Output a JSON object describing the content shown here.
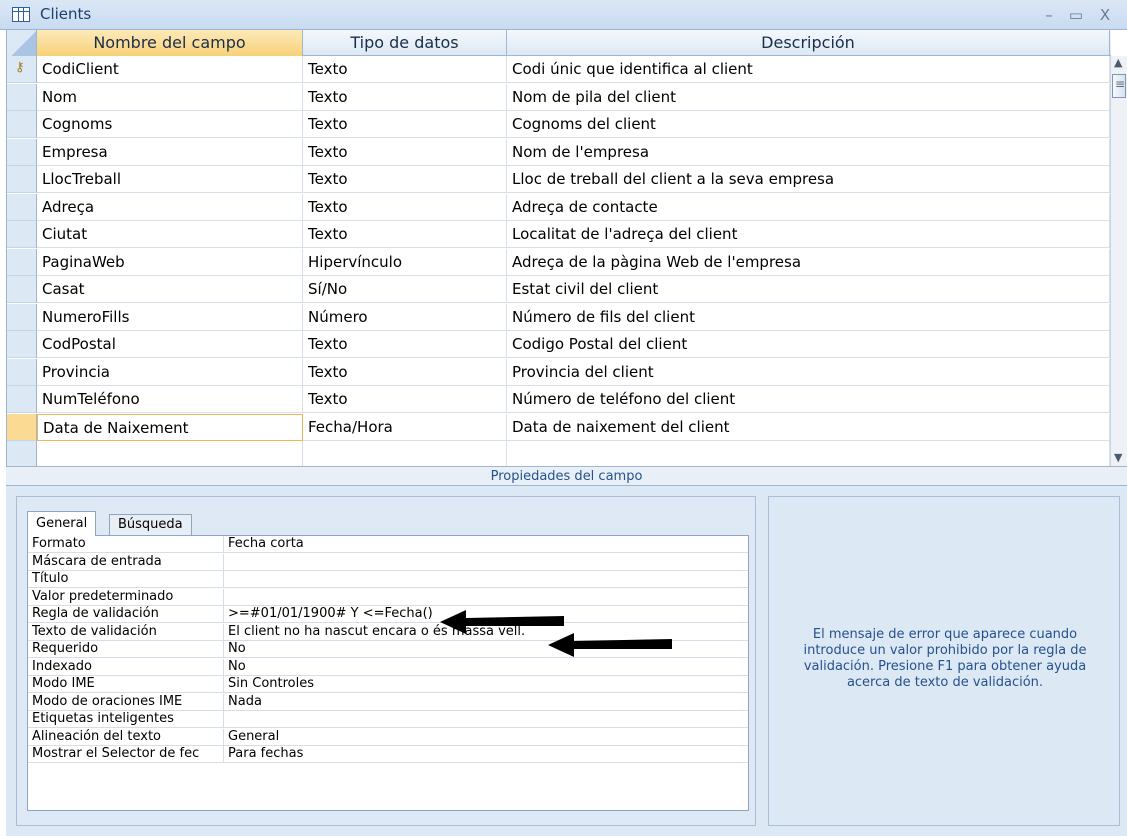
{
  "window": {
    "title": "Clients",
    "minimize": "–",
    "maximize": "▭",
    "close": "X"
  },
  "grid": {
    "columns": {
      "name": "Nombre del campo",
      "type": "Tipo de datos",
      "desc": "Descripción"
    },
    "rows": [
      {
        "name": "CodiClient",
        "type": "Texto",
        "desc": "Codi únic que identifica al client",
        "key": true
      },
      {
        "name": "Nom",
        "type": "Texto",
        "desc": "Nom de pila del client"
      },
      {
        "name": "Cognoms",
        "type": "Texto",
        "desc": "Cognoms del client"
      },
      {
        "name": "Empresa",
        "type": "Texto",
        "desc": "Nom de l'empresa"
      },
      {
        "name": "LlocTreball",
        "type": "Texto",
        "desc": "Lloc de treball del client a la seva empresa"
      },
      {
        "name": "Adreça",
        "type": "Texto",
        "desc": "Adreça de contacte"
      },
      {
        "name": "Ciutat",
        "type": "Texto",
        "desc": "Localitat de l'adreça del client"
      },
      {
        "name": "PaginaWeb",
        "type": "Hipervínculo",
        "desc": "Adreça de la pàgina Web de l'empresa"
      },
      {
        "name": "Casat",
        "type": "Sí/No",
        "desc": "Estat civil del client"
      },
      {
        "name": "NumeroFills",
        "type": "Número",
        "desc": "Número de fils del client"
      },
      {
        "name": "CodPostal",
        "type": "Texto",
        "desc": "Codigo Postal del client"
      },
      {
        "name": "Provincia",
        "type": "Texto",
        "desc": "Provincia del client"
      },
      {
        "name": "NumTeléfono",
        "type": "Texto",
        "desc": "Número de teléfono del client"
      },
      {
        "name": "Data de Naixement",
        "type": "Fecha/Hora",
        "desc": "Data de naixement del client",
        "active": true
      },
      {
        "name": "",
        "type": "",
        "desc": ""
      }
    ]
  },
  "properties": {
    "band_label": "Propiedades del campo",
    "tabs": [
      "General",
      "Búsqueda"
    ],
    "rows": [
      {
        "label": "Formato",
        "value": "Fecha corta"
      },
      {
        "label": "Máscara de entrada",
        "value": ""
      },
      {
        "label": "Título",
        "value": ""
      },
      {
        "label": "Valor predeterminado",
        "value": ""
      },
      {
        "label": "Regla de validación",
        "value": ">=#01/01/1900# Y <=Fecha()"
      },
      {
        "label": "Texto de validación",
        "value": "El client no ha nascut encara o és massa vell."
      },
      {
        "label": "Requerido",
        "value": "No"
      },
      {
        "label": "Indexado",
        "value": "No"
      },
      {
        "label": "Modo IME",
        "value": "Sin Controles"
      },
      {
        "label": "Modo de oraciones IME",
        "value": "Nada"
      },
      {
        "label": "Etiquetas inteligentes",
        "value": ""
      },
      {
        "label": "Alineación del texto",
        "value": "General"
      },
      {
        "label": "Mostrar el Selector de fec",
        "value": "Para fechas"
      }
    ],
    "help": "El mensaje de error que aparece cuando introduce un valor prohibido por la regla de validación. Presione F1 para obtener ayuda acerca de texto de validación."
  },
  "colors": {
    "accent_active": "#fbdb94",
    "header_active": "#f8d27a",
    "panel_bg": "#dde8f5",
    "help_text": "#24528c"
  }
}
